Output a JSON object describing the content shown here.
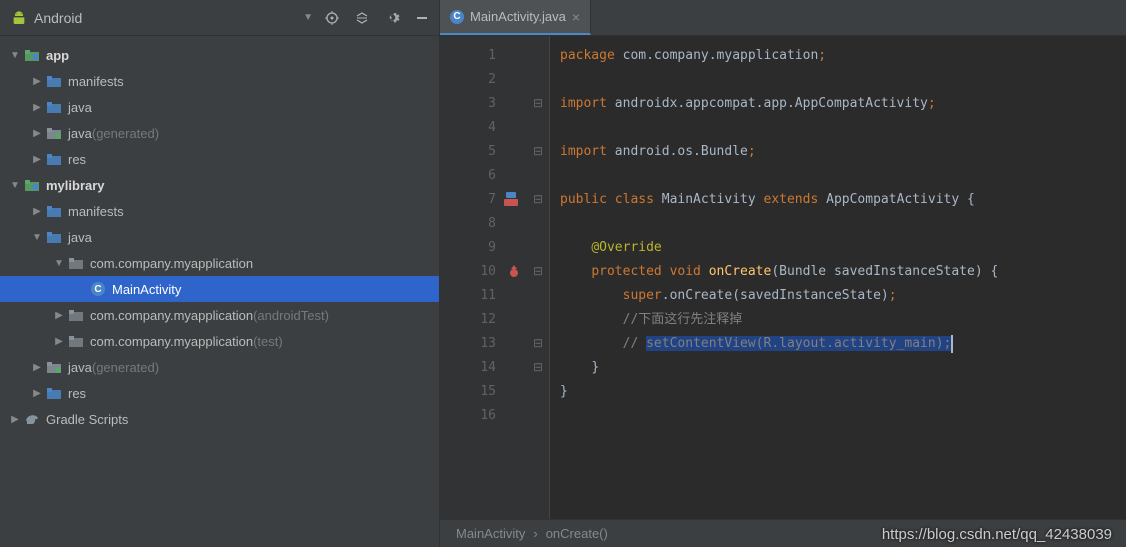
{
  "sidebar": {
    "title": "Android",
    "tree": [
      {
        "indent": 0,
        "arrow": "▼",
        "icon": "module",
        "label": "app",
        "bold": true
      },
      {
        "indent": 1,
        "arrow": "▶",
        "icon": "folder",
        "label": "manifests"
      },
      {
        "indent": 1,
        "arrow": "▶",
        "icon": "folder",
        "label": "java"
      },
      {
        "indent": 1,
        "arrow": "▶",
        "icon": "folder-gen",
        "label": "java",
        "suffix": "(generated)"
      },
      {
        "indent": 1,
        "arrow": "▶",
        "icon": "folder",
        "label": "res"
      },
      {
        "indent": 0,
        "arrow": "▼",
        "icon": "module",
        "label": "mylibrary",
        "bold": true
      },
      {
        "indent": 1,
        "arrow": "▶",
        "icon": "folder",
        "label": "manifests"
      },
      {
        "indent": 1,
        "arrow": "▼",
        "icon": "folder",
        "label": "java"
      },
      {
        "indent": 2,
        "arrow": "▼",
        "icon": "package",
        "label": "com.company.myapplication"
      },
      {
        "indent": 3,
        "arrow": "",
        "icon": "class",
        "label": "MainActivity",
        "selected": true
      },
      {
        "indent": 2,
        "arrow": "▶",
        "icon": "package",
        "label": "com.company.myapplication",
        "suffix": "(androidTest)"
      },
      {
        "indent": 2,
        "arrow": "▶",
        "icon": "package",
        "label": "com.company.myapplication",
        "suffix": "(test)"
      },
      {
        "indent": 1,
        "arrow": "▶",
        "icon": "folder-gen",
        "label": "java",
        "suffix": "(generated)"
      },
      {
        "indent": 1,
        "arrow": "▶",
        "icon": "folder",
        "label": "res"
      },
      {
        "indent": 0,
        "arrow": "▶",
        "icon": "gradle",
        "label": "Gradle Scripts"
      }
    ]
  },
  "tab": {
    "label": "MainActivity.java"
  },
  "code": {
    "line1": {
      "a": "package",
      "b": " com.company.myapplication",
      "c": ";"
    },
    "line3": {
      "a": "import",
      "b": " androidx.appcompat.app.AppCompatActivity",
      "c": ";"
    },
    "line5": {
      "a": "import",
      "b": " android.os.Bundle",
      "c": ";"
    },
    "line7": {
      "a": "public class",
      "b": " MainActivity ",
      "c": "extends",
      "d": " AppCompatActivity {"
    },
    "line9": "@Override",
    "line10": {
      "a": "protected void ",
      "b": "onCreate",
      "c": "(Bundle savedInstanceState) {"
    },
    "line11": {
      "a": "super",
      "b": ".onCreate(savedInstanceState)",
      "c": ";"
    },
    "line12": "//下面这行先注释掉",
    "line13": {
      "a": "// ",
      "b": "setContentView(R.layout.activity_main);"
    },
    "line14": "}",
    "line15": "}"
  },
  "lineNumbers": [
    "1",
    "2",
    "3",
    "4",
    "5",
    "6",
    "7",
    "8",
    "9",
    "10",
    "11",
    "12",
    "13",
    "14",
    "15",
    "16"
  ],
  "breadcrumb": {
    "a": "MainActivity",
    "sep": "›",
    "b": "onCreate()"
  },
  "watermark": "https://blog.csdn.net/qq_42438039"
}
